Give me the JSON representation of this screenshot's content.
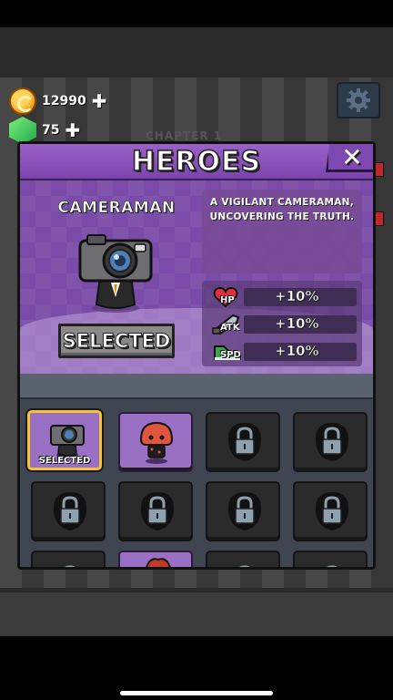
{
  "currencies": {
    "coins": {
      "value": "12990",
      "icon": "coin-icon"
    },
    "gems": {
      "value": "75",
      "icon": "gem-icon"
    }
  },
  "background": {
    "chapter_label": "CHAPTER 1"
  },
  "panel": {
    "title": "HEROES",
    "close_label": "✕",
    "hero": {
      "name": "CAMERAMAN",
      "description": "A VIGILANT CAMERAMAN, UNCOVERING THE TRUTH.",
      "status_button": "SELECTED",
      "stats": [
        {
          "abbr": "HP",
          "value": "+10%",
          "icon": "heart-icon",
          "color": "#e0303a"
        },
        {
          "abbr": "ATK",
          "value": "+10%",
          "icon": "dagger-icon",
          "color": "#9aa3ad"
        },
        {
          "abbr": "SPD",
          "value": "+10%",
          "icon": "sneaker-icon",
          "color": "#3aa84a"
        }
      ]
    },
    "roster": [
      {
        "hero": "cameraman",
        "state": "selected",
        "label": "SELECTED"
      },
      {
        "hero": "mushroom",
        "state": "unlocked",
        "label": ""
      },
      {
        "hero": "locked",
        "state": "locked",
        "label": ""
      },
      {
        "hero": "locked",
        "state": "locked",
        "label": ""
      },
      {
        "hero": "locked",
        "state": "locked",
        "label": ""
      },
      {
        "hero": "locked",
        "state": "locked",
        "label": ""
      },
      {
        "hero": "locked",
        "state": "locked",
        "label": ""
      },
      {
        "hero": "locked",
        "state": "locked",
        "label": ""
      },
      {
        "hero": "locked",
        "state": "locked",
        "label": ""
      },
      {
        "hero": "partial-red",
        "state": "unlocked",
        "label": ""
      },
      {
        "hero": "locked",
        "state": "locked",
        "label": ""
      },
      {
        "hero": "locked",
        "state": "locked",
        "label": ""
      }
    ]
  },
  "colors": {
    "panel_purple": "#7a4ba8",
    "selected_border": "#f4c436",
    "locked_slot": "#2b2b2b"
  }
}
